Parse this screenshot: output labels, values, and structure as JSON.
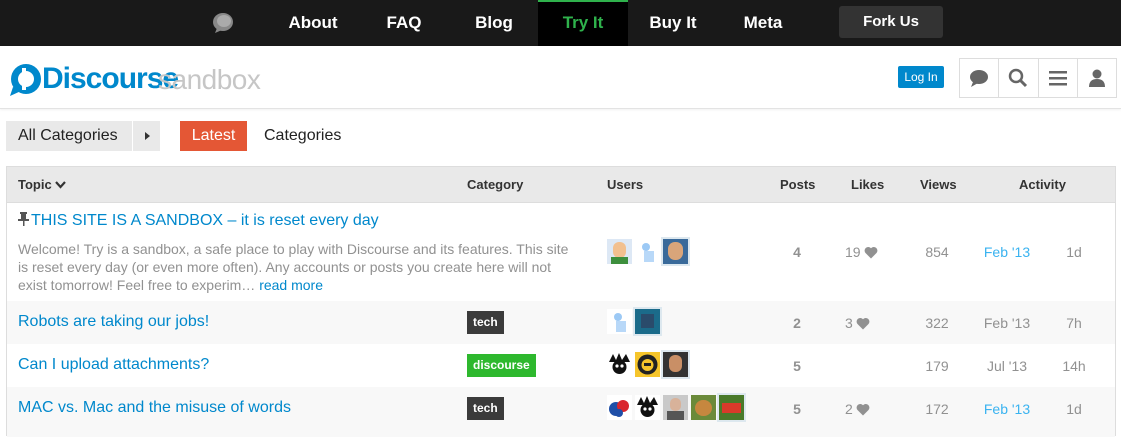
{
  "topnav": {
    "links": [
      "About",
      "FAQ",
      "Blog",
      "Try It",
      "Buy It",
      "Meta"
    ],
    "active_label": "Try It",
    "fork_label": "Fork Us",
    "accent": "#2fb24c"
  },
  "header": {
    "logo_text": "Discourse",
    "logo_sub": "sandbox",
    "login_label": "Log In",
    "icons": [
      "chat-icon",
      "search-icon",
      "menu-icon",
      "user-icon"
    ],
    "brand_color": "#0088cc"
  },
  "nav": {
    "category_select": "All Categories",
    "tabs": [
      "Latest",
      "Categories"
    ],
    "active_tab_color": "#e45735"
  },
  "table": {
    "columns": [
      "Topic",
      "Category",
      "Users",
      "Posts",
      "Likes",
      "Views",
      "Activity"
    ],
    "rows": [
      {
        "pinned": true,
        "title": "THIS SITE IS A SANDBOX – it is reset every day",
        "excerpt": "Welcome! Try is a sandbox, a safe place to play with Discourse and its features. This site is reset every day (or even more often). Any accounts or posts you create here will not exist tomorrow! Feel free to experim…",
        "read_more": "read more",
        "category": "",
        "posts": "4",
        "likes": "19",
        "views": "854",
        "first_post": "Feb '13",
        "last_activity": "1d"
      },
      {
        "title": "Robots are taking our jobs!",
        "category": "tech",
        "category_color": "#3b3b3b",
        "posts": "2",
        "likes": "3",
        "views": "322",
        "first_post": "Feb '13",
        "last_activity": "7h"
      },
      {
        "title": "Can I upload attachments?",
        "category": "discourse",
        "category_color": "#2eb82e",
        "posts": "5",
        "likes": "",
        "views": "179",
        "first_post": "Jul '13",
        "last_activity": "14h"
      },
      {
        "title": "MAC vs. Mac and the misuse of words",
        "category": "tech",
        "category_color": "#3b3b3b",
        "posts": "5",
        "likes": "2",
        "views": "172",
        "first_post": "Feb '13",
        "last_activity": "1d"
      }
    ]
  }
}
